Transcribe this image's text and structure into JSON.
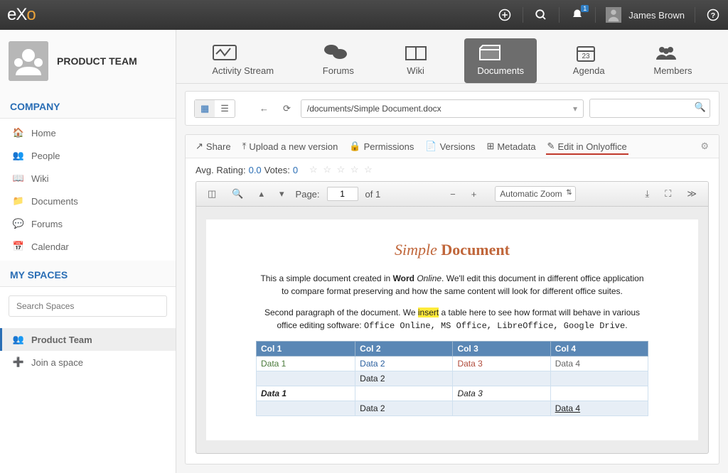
{
  "topbar": {
    "username": "James Brown",
    "notification_count": "1"
  },
  "team": {
    "name": "PRODUCT TEAM"
  },
  "sidebar": {
    "company_label": "COMPANY",
    "company_items": [
      {
        "label": "Home"
      },
      {
        "label": "People"
      },
      {
        "label": "Wiki"
      },
      {
        "label": "Documents"
      },
      {
        "label": "Forums"
      },
      {
        "label": "Calendar"
      }
    ],
    "myspaces_label": "MY SPACES",
    "search_placeholder": "Search Spaces",
    "spaces": [
      {
        "label": "Product Team",
        "active": true
      },
      {
        "label": "Join a space",
        "active": false
      }
    ]
  },
  "tabs": [
    {
      "label": "Activity Stream"
    },
    {
      "label": "Forums"
    },
    {
      "label": "Wiki"
    },
    {
      "label": "Documents",
      "active": true
    },
    {
      "label": "Agenda"
    },
    {
      "label": "Members"
    }
  ],
  "path": "/documents/Simple Document.docx",
  "actions": {
    "share": "Share",
    "upload": "Upload a new version",
    "permissions": "Permissions",
    "versions": "Versions",
    "metadata": "Metadata",
    "edit": "Edit in Onlyoffice"
  },
  "rating": {
    "avg_label": "Avg. Rating:",
    "avg_value": "0.0",
    "votes_label": "Votes:",
    "votes_value": "0"
  },
  "viewer": {
    "page_label": "Page:",
    "page_current": "1",
    "page_of": "of 1",
    "zoom": "Automatic Zoom"
  },
  "document": {
    "title_simple": "Simple",
    "title_document": "Document",
    "para1_a": "This a simple document created in ",
    "para1_b": "Word",
    "para1_c": " Online",
    "para1_d": ". We'll edit this document in different office application to compare format preserving and how the same content will look for different office suites.",
    "para2_a": "Second paragraph of the document. We ",
    "para2_hl": "insert",
    "para2_b": " a table here to see how format will behave in various office editing software: ",
    "para2_mono": "Office Online, MS Office, LibreOffice, Google Drive",
    "para2_end": ".",
    "table": {
      "headers": [
        "Col 1",
        "Col 2",
        "Col 3",
        "Col 4"
      ],
      "rows": [
        [
          "Data 1",
          "Data 2",
          "Data 3",
          "Data 4"
        ],
        [
          "",
          "Data 2",
          "",
          ""
        ],
        [
          "Data 1",
          "",
          "Data 3",
          ""
        ],
        [
          "",
          "Data 2",
          "",
          "Data 4"
        ]
      ]
    }
  }
}
